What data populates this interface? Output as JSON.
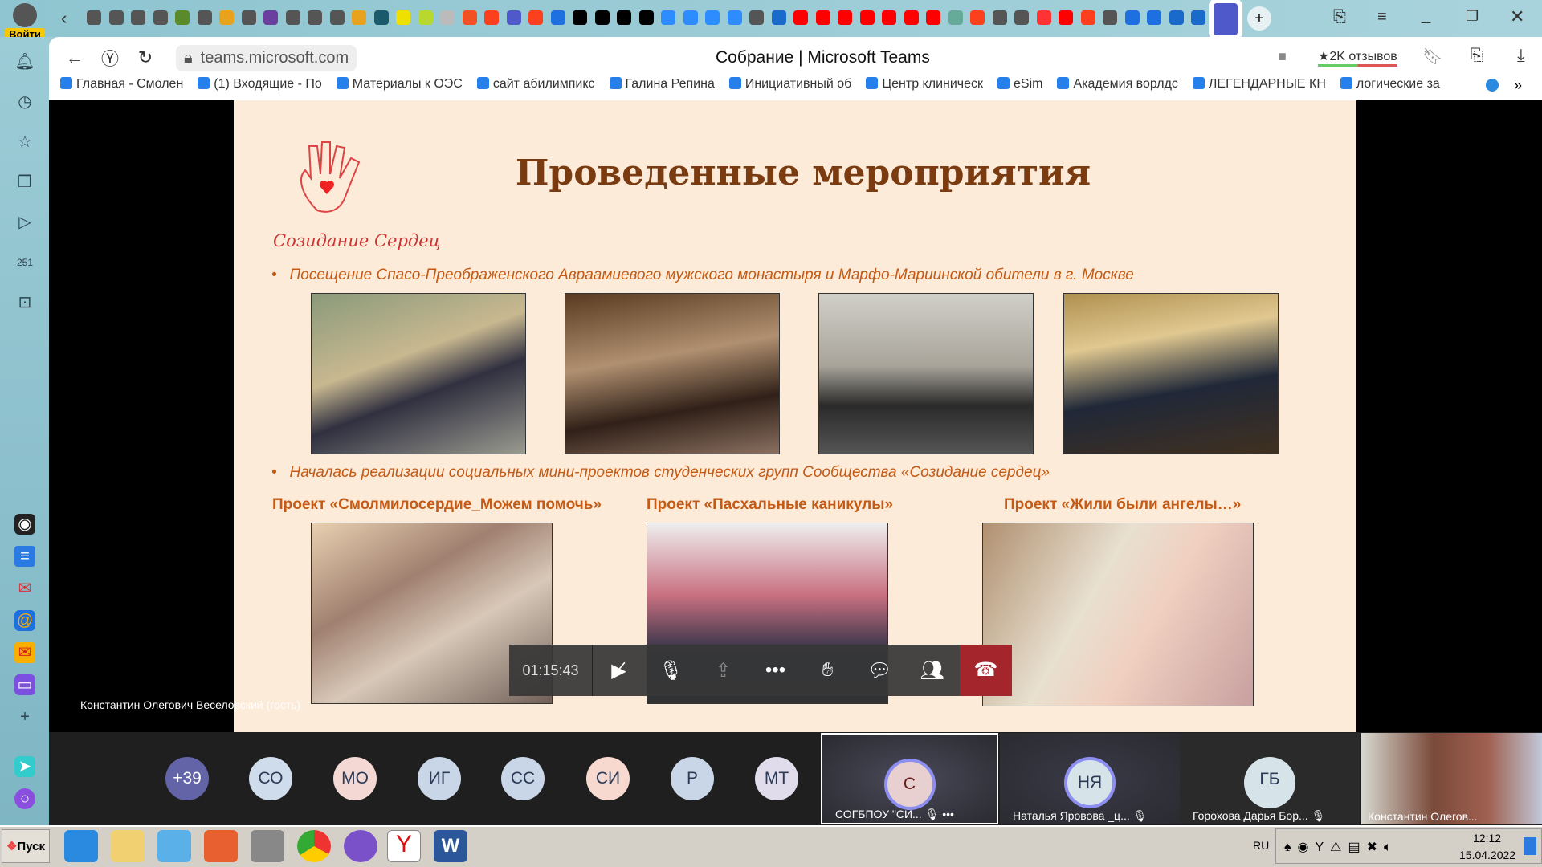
{
  "browser": {
    "login_label": "Войти",
    "url": "teams.microsoft.com",
    "page_title": "Собрание | Microsoft Teams",
    "reviews": "★2K отзывов",
    "bookmarks": [
      "Главная - Смолен",
      "(1) Входящие - По",
      "Материалы к ОЭС",
      "сайт абилимпикс",
      "Галина Репина",
      "Инициативный об",
      "Центр клиническ",
      "eSim",
      "Академия ворлдс",
      "ЛЕГЕНДАРНЫЕ КН",
      "логические за"
    ],
    "tab_colors": [
      "#555",
      "#555",
      "#555",
      "#555",
      "#5a8a2a",
      "#555",
      "#e8a21c",
      "#555",
      "#6b3fa0",
      "#555",
      "#555",
      "#555",
      "#e8a21c",
      "#1a5a6a",
      "#f0e000",
      "#b8d830",
      "#bbb",
      "#f25022",
      "#fc3f1d",
      "#5059c9",
      "#fc3f1d",
      "#1e6fe0",
      "#000",
      "#000",
      "#000",
      "#000",
      "#2d8cff",
      "#2d8cff",
      "#2d8cff",
      "#2d8cff",
      "#555",
      "#1a6acc",
      "#f00",
      "#f00",
      "#f00",
      "#f00",
      "#f00",
      "#f00",
      "#f00",
      "#6a9",
      "#fc3f1d",
      "#555",
      "#555",
      "#f33",
      "#f00",
      "#fc3f1d",
      "#555",
      "#1e6fe0",
      "#1e6fe0",
      "#1a6acc",
      "#1a6acc",
      "#5059c9"
    ]
  },
  "slide": {
    "title": "Проведенные мероприятия",
    "logo_text": "Созидание Сердец",
    "bullet1": "Посещение Спасо-Преображенского Авраамиевого мужского монастыря и Марфо-Мариинской обители в г. Москве",
    "bullet2": "Началась реализации социальных мини-проектов студенческих групп Сообщества «Созидание сердец»",
    "projects": [
      "Проект «Смолмилосердие_Можем помочь»",
      "Проект «Пасхальные каникулы»",
      "Проект «Жили были ангелы…»"
    ]
  },
  "call": {
    "timer": "01:15:43",
    "presenter": "Константин Олегович Веселовский (гость)",
    "avatars": [
      {
        "t": "+39",
        "c": "#6264a7"
      },
      {
        "t": "СО",
        "c": "#cfdcec"
      },
      {
        "t": "МО",
        "c": "#f4d8d4"
      },
      {
        "t": "ИГ",
        "c": "#c8d6e8"
      },
      {
        "t": "СС",
        "c": "#c8d6e8"
      },
      {
        "t": "СИ",
        "c": "#f7d9d0"
      },
      {
        "t": "Р",
        "c": "#c8d6e8"
      },
      {
        "t": "МТ",
        "c": "#e0dcec"
      }
    ],
    "tiles": [
      {
        "initials": "С",
        "name": "СОГБПОУ \"СИ...",
        "c": "#e8d0d0"
      },
      {
        "initials": "НЯ",
        "name": "Наталья Яровова _ц...",
        "c": "#d6e4ea"
      },
      {
        "initials": "ГБ",
        "name": "Горохова Дарья Бор...",
        "c": "#d6e4ea"
      },
      {
        "name": "Константин Олегов..."
      }
    ]
  },
  "taskbar": {
    "start": "Пуск",
    "lang": "RU",
    "time": "12:12",
    "date": "15.04.2022"
  }
}
